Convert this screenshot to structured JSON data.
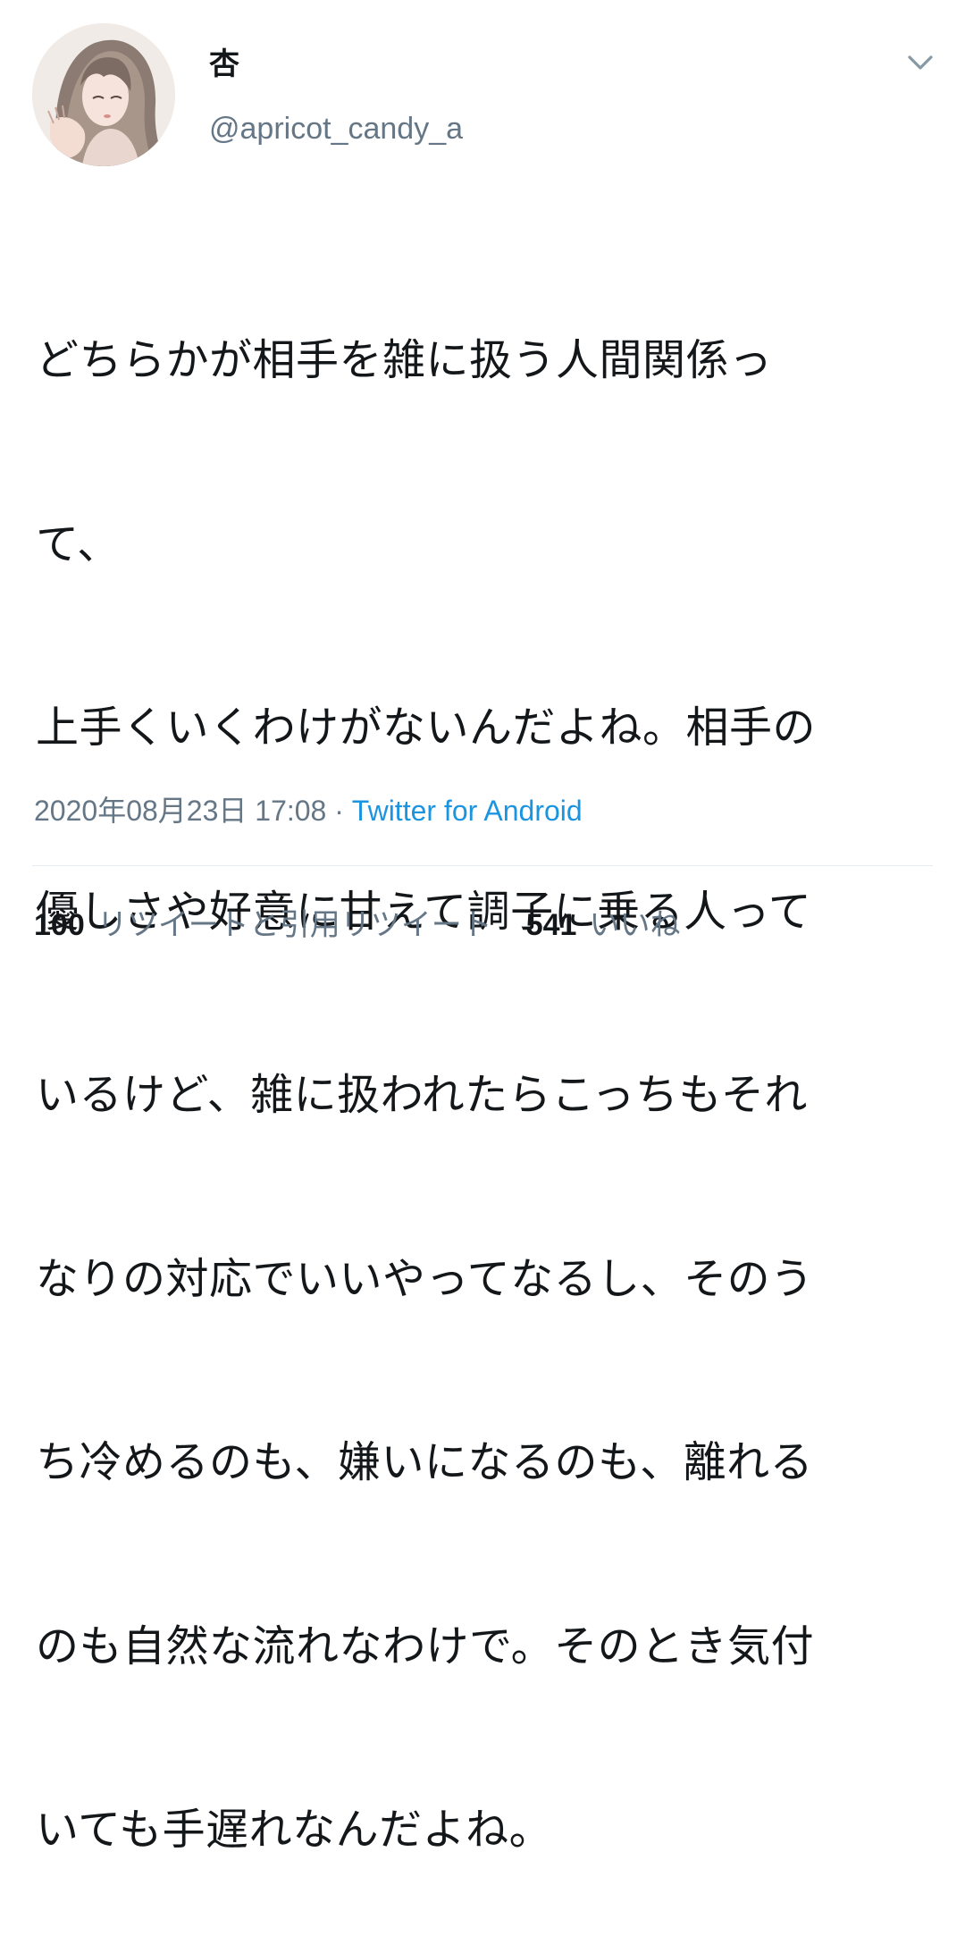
{
  "user": {
    "display_name": "杏",
    "handle": "@apricot_candy_a"
  },
  "tweet": {
    "lines": [
      "どちらかが相手を雑に扱う人間関係っ",
      "て、",
      "上手くいくわけがないんだよね。相手の",
      "優しさや好意に甘えて調子に乗る人って",
      "いるけど、雑に扱われたらこっちもそれ",
      "なりの対応でいいやってなるし、そのう",
      "ち冷めるのも、嫌いになるのも、離れる",
      "のも自然な流れなわけで。そのとき気付",
      "いても手遅れなんだよね。"
    ],
    "timestamp": "2020年08月23日 17:08",
    "separator": " · ",
    "source": "Twitter for Android"
  },
  "stats": {
    "retweets_count": "100",
    "retweets_label": "リツイートと引用リツイート",
    "likes_count": "541",
    "likes_label": "いいね"
  },
  "icons": {
    "menu": "chevron-down-icon",
    "avatar": "profile-avatar"
  },
  "colors": {
    "text_primary": "#14171a",
    "text_secondary": "#657786",
    "link": "#1b95e0",
    "divider": "#e6ecf0"
  }
}
